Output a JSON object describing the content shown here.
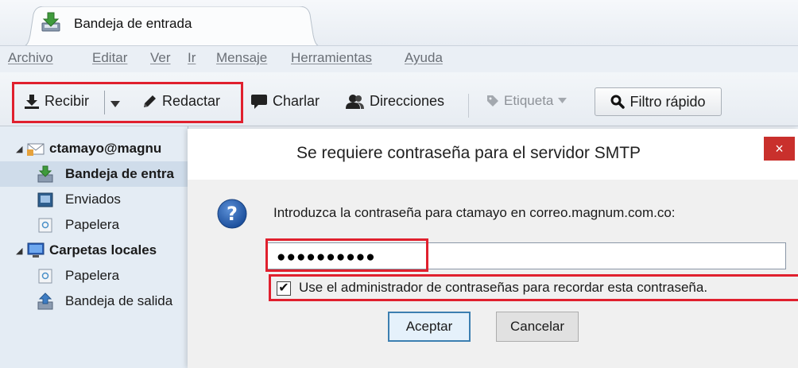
{
  "tab": {
    "title": "Bandeja de entrada",
    "icon": "inbox-download-icon"
  },
  "menu": [
    "Archivo",
    "Editar",
    "Ver",
    "Ir",
    "Mensaje",
    "Herramientas",
    "Ayuda"
  ],
  "toolbar": {
    "get_mail": "Recibir",
    "write": "Redactar",
    "chat": "Charlar",
    "address_book": "Direcciones",
    "tag": "Etiqueta",
    "quick_filter": "Filtro rápido"
  },
  "folders": {
    "account": "ctamayo@magnu",
    "inbox": "Bandeja de entra",
    "sent": "Enviados",
    "trash": "Papelera",
    "local": "Carpetas locales",
    "local_trash": "Papelera",
    "outbox": "Bandeja de salida"
  },
  "dialog": {
    "title": "Se requiere contraseña para el servidor SMTP",
    "close": "×",
    "prompt": "Introduzca la contraseña para ctamayo en correo.magnum.com.co:",
    "password_mask": "●●●●●●●●●●",
    "remember_label": "Use el administrador de contraseñas para recordar esta contraseña.",
    "remember_checked": "✔",
    "ok": "Aceptar",
    "cancel": "Cancelar"
  },
  "colors": {
    "highlight": "#e0202e",
    "selected_row": "#cfdcea",
    "close_button": "#c9302c"
  }
}
